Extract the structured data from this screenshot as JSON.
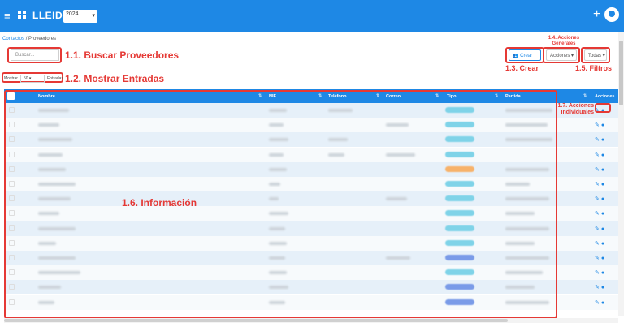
{
  "topbar": {
    "brand": "LLEIDA 1",
    "year": "2024",
    "plus": "+"
  },
  "breadcrumb": {
    "root": "Contactos",
    "separator": "/",
    "current": "Proveedores"
  },
  "search": {
    "placeholder": "Buscar..."
  },
  "entries": {
    "show_label": "Mostrar",
    "value": "50",
    "suffix": "Entradas"
  },
  "toolbar": {
    "create": "Crear",
    "actions": "Acciones",
    "filter": "Todas"
  },
  "table": {
    "columns": [
      "Nombre",
      "NIF",
      "Teléfono",
      "Correo",
      "Tipo",
      "Partida",
      "Acciones"
    ],
    "pill_colors": [
      "#7fd3e8",
      "#7fd3e8",
      "#7fd3e8",
      "#7fd3e8",
      "#f7b26a",
      "#7fd3e8",
      "#7fd3e8",
      "#7fd3e8",
      "#7fd3e8",
      "#7fd3e8",
      "#7a9be8",
      "#7fd3e8",
      "#7a9be8",
      "#7a9be8"
    ]
  },
  "annotations": {
    "search": "1.1. Buscar Proveedores",
    "entries": "1.2. Mostrar Entradas",
    "create": "1.3. Crear",
    "actions_title": "1.4. Acciones Generales",
    "filters": "1.5. Filtros",
    "info": "1.6. Información",
    "row_actions": "1.7. Acciones Individuales"
  },
  "colors": {
    "accent": "#1e88e5",
    "annotation": "#e53935"
  }
}
